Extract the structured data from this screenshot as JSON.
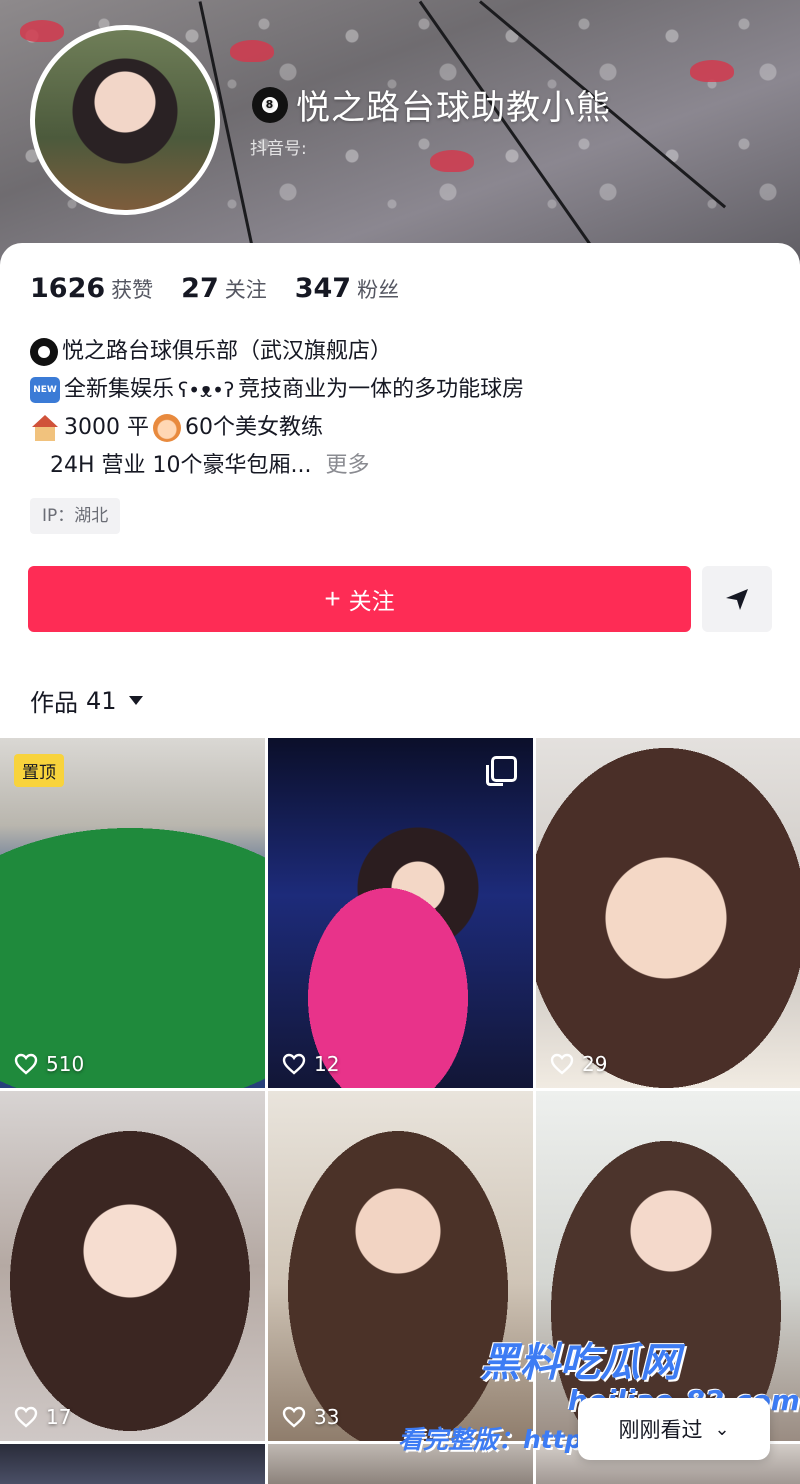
{
  "profile": {
    "name": "悦之路台球助教小熊",
    "douyin_id_label": "抖音号:"
  },
  "stats": [
    {
      "value": "1626",
      "label": "获赞"
    },
    {
      "value": "27",
      "label": "关注"
    },
    {
      "value": "347",
      "label": "粉丝"
    }
  ],
  "bio": {
    "line1": "悦之路台球俱乐部（武汉旗舰店）",
    "line2_tag": "NEW",
    "line2": "全新集娱乐",
    "line2b": "竞技商业为一体的多功能球房",
    "line3a": "3000 平",
    "line3b": "60个美女教练",
    "line4": "24H 营业 10个豪华包厢...",
    "more": "更多"
  },
  "ip_label": "IP：湖北",
  "actions": {
    "follow_label": "关注",
    "follow_plus": "+"
  },
  "works_tab": {
    "label": "作品",
    "count": "41"
  },
  "videos": [
    {
      "likes": "510",
      "pinned_label": "置顶"
    },
    {
      "likes": "12",
      "multi": true
    },
    {
      "likes": "29"
    },
    {
      "likes": "17"
    },
    {
      "likes": "33"
    },
    {
      "likes": ""
    }
  ],
  "recent_button": {
    "label": "刚刚看过",
    "chevron": "⌄"
  },
  "watermark": {
    "brand": "黑料吃瓜网",
    "url": "heiliao-82.com",
    "cta": "看完整版：https://"
  },
  "colors": {
    "accent": "#fe2c55",
    "pin_badge": "#f8d33c",
    "watermark": "#3d7cf4"
  }
}
